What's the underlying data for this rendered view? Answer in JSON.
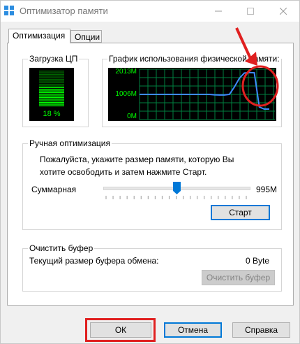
{
  "window": {
    "title": "Оптимизатор памяти"
  },
  "tabs": [
    {
      "label": "Оптимизация",
      "active": true
    },
    {
      "label": "Опции",
      "active": false
    }
  ],
  "cpu": {
    "group_title": "Загрузка ЦП",
    "percent_label": "18 %",
    "load_fraction": 0.18
  },
  "memory_graph": {
    "group_title": "График использования физической памяти:",
    "y_labels": [
      "2013M",
      "1006M",
      "0M"
    ],
    "chart_data": {
      "type": "line",
      "ylim": [
        0,
        2013
      ],
      "y_unit": "M",
      "series": [
        {
          "values": [
            1006,
            1006,
            1006,
            1006,
            1006,
            1006,
            1006,
            1006,
            1006,
            1006,
            1006,
            1006,
            1006,
            1006,
            1006,
            990,
            980,
            980,
            1006,
            1300,
            1650,
            1860,
            1880,
            1870,
            500,
            420,
            420
          ]
        }
      ]
    }
  },
  "manual": {
    "group_title": "Ручная оптимизация",
    "instruction": "Пожалуйста, укажите размер памяти, которую Вы хотите освободить и затем нажмите Старт.",
    "slider_label": "Суммарная",
    "slider_value": "995M",
    "slider_fraction": 0.5,
    "start_button": "Старт"
  },
  "clipboard": {
    "group_title": "Очистить буфер",
    "size_label": "Текущий размер буфера обмена:",
    "size_value": "0 Byte",
    "clear_button": "Очистить буфер"
  },
  "footer": {
    "ok": "ОК",
    "cancel": "Отмена",
    "help": "Справка"
  },
  "colors": {
    "accent": "#0078d7",
    "graph_grid": "#008040",
    "graph_line": "#3d8bff",
    "highlight": "#e02020"
  }
}
